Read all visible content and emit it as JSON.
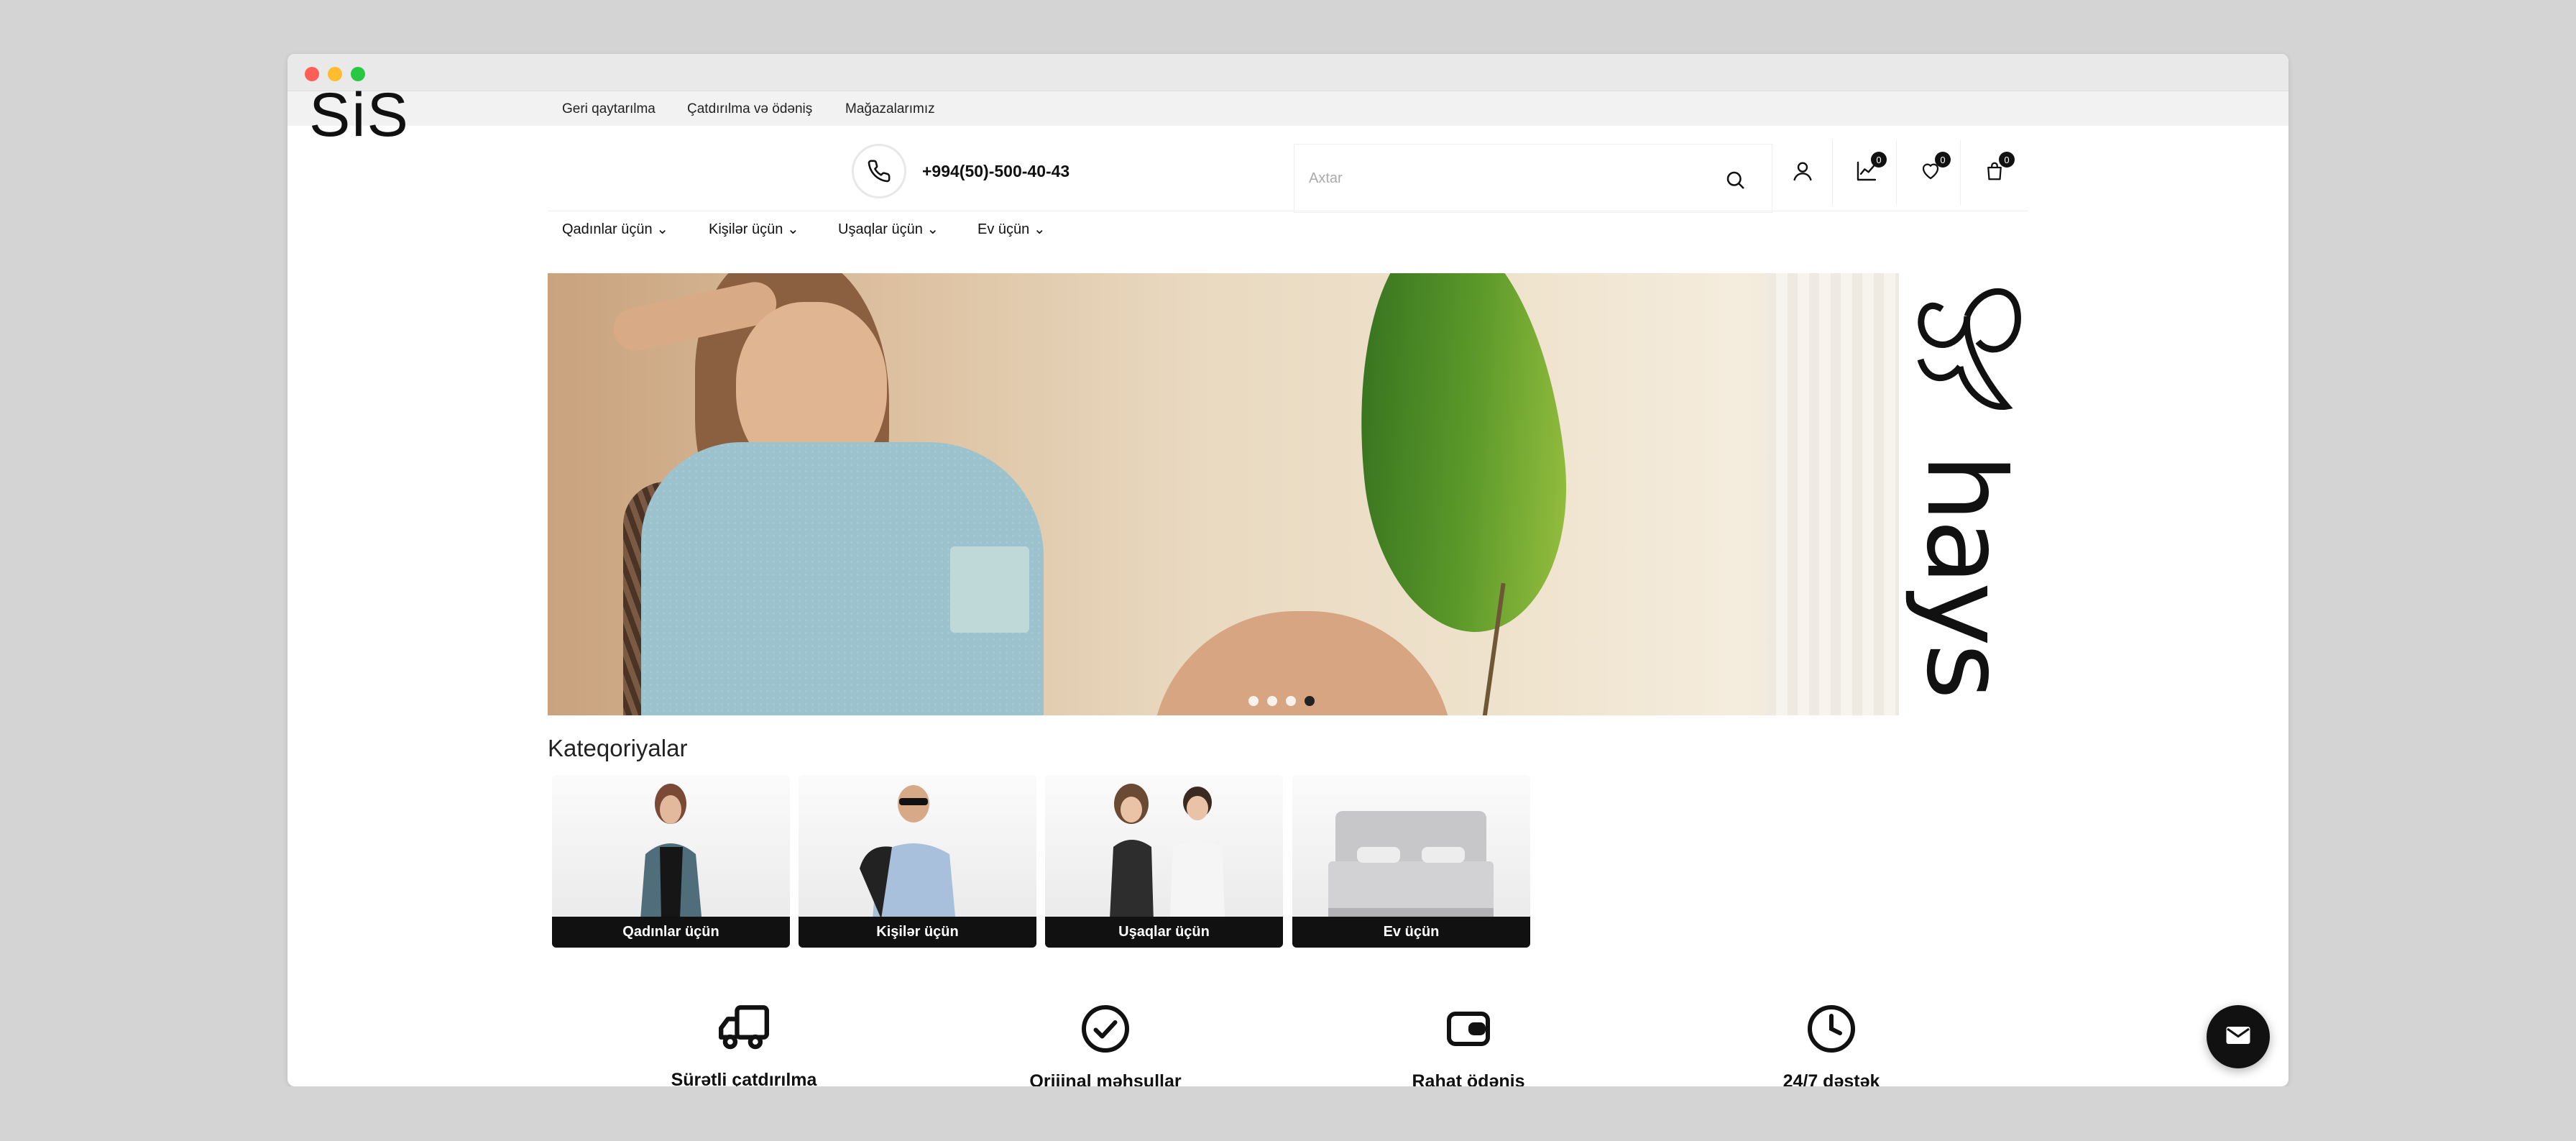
{
  "colors": {
    "brand": "#111111",
    "accent_red": "#ff5f57",
    "accent_yellow": "#febc2e",
    "accent_green": "#28c840"
  },
  "topbar": {
    "links": [
      "Geri qaytarılma",
      "Çatdırılma və ödəniş",
      "Mağazalarımız"
    ]
  },
  "header": {
    "logo": "SiS",
    "phone": "+994(50)-500-40-43",
    "search_placeholder": "Axtar",
    "icons": [
      {
        "name": "user-icon"
      },
      {
        "name": "compare-icon",
        "badge": "0"
      },
      {
        "name": "heart-icon",
        "badge": "0"
      },
      {
        "name": "bag-icon",
        "badge": "0"
      }
    ]
  },
  "nav": {
    "items": [
      "Qadınlar üçün",
      "Kişilər üçün",
      "Uşaqlar üçün",
      "Ev üçün"
    ]
  },
  "hero": {
    "brand": "hays",
    "slides_total": 4,
    "active_slide": 4
  },
  "categories": {
    "title": "Kateqoriyalar",
    "items": [
      "Qadınlar üçün",
      "Kişilər üçün",
      "Uşaqlar üçün",
      "Ev üçün"
    ]
  },
  "features": {
    "items": [
      "Sürətli çatdırılma",
      "Orijinal məhsullar",
      "Rahat ödəniş",
      "24/7 dəstək"
    ]
  }
}
